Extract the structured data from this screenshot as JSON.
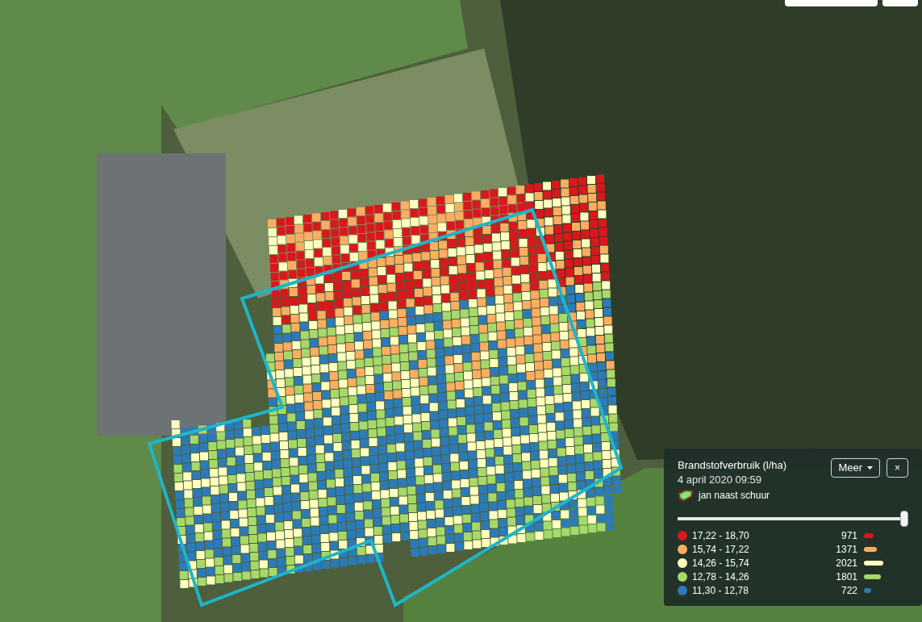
{
  "map_controls": [
    {
      "kind": "button"
    },
    {
      "kind": "button"
    }
  ],
  "legend": {
    "title": "Brandstofverbruik (l/ha)",
    "datetime": "4 april 2020 09:59",
    "field": "jan naast schuur",
    "more_button": "Meer",
    "close_button": "×",
    "slider": {
      "level": 1
    },
    "classes": [
      {
        "range": "17,22 - 18,70",
        "count": "971",
        "color": "#d7191c"
      },
      {
        "range": "15,74 - 17,22",
        "count": "1371",
        "color": "#fdae61"
      },
      {
        "range": "14,26 - 15,74",
        "count": "2021",
        "color": "#ffffbf"
      },
      {
        "range": "12,78 - 14,26",
        "count": "1801",
        "color": "#a6d96a"
      },
      {
        "range": "11,30 - 12,78",
        "count": "722",
        "color": "#2c7bb6"
      }
    ]
  }
}
